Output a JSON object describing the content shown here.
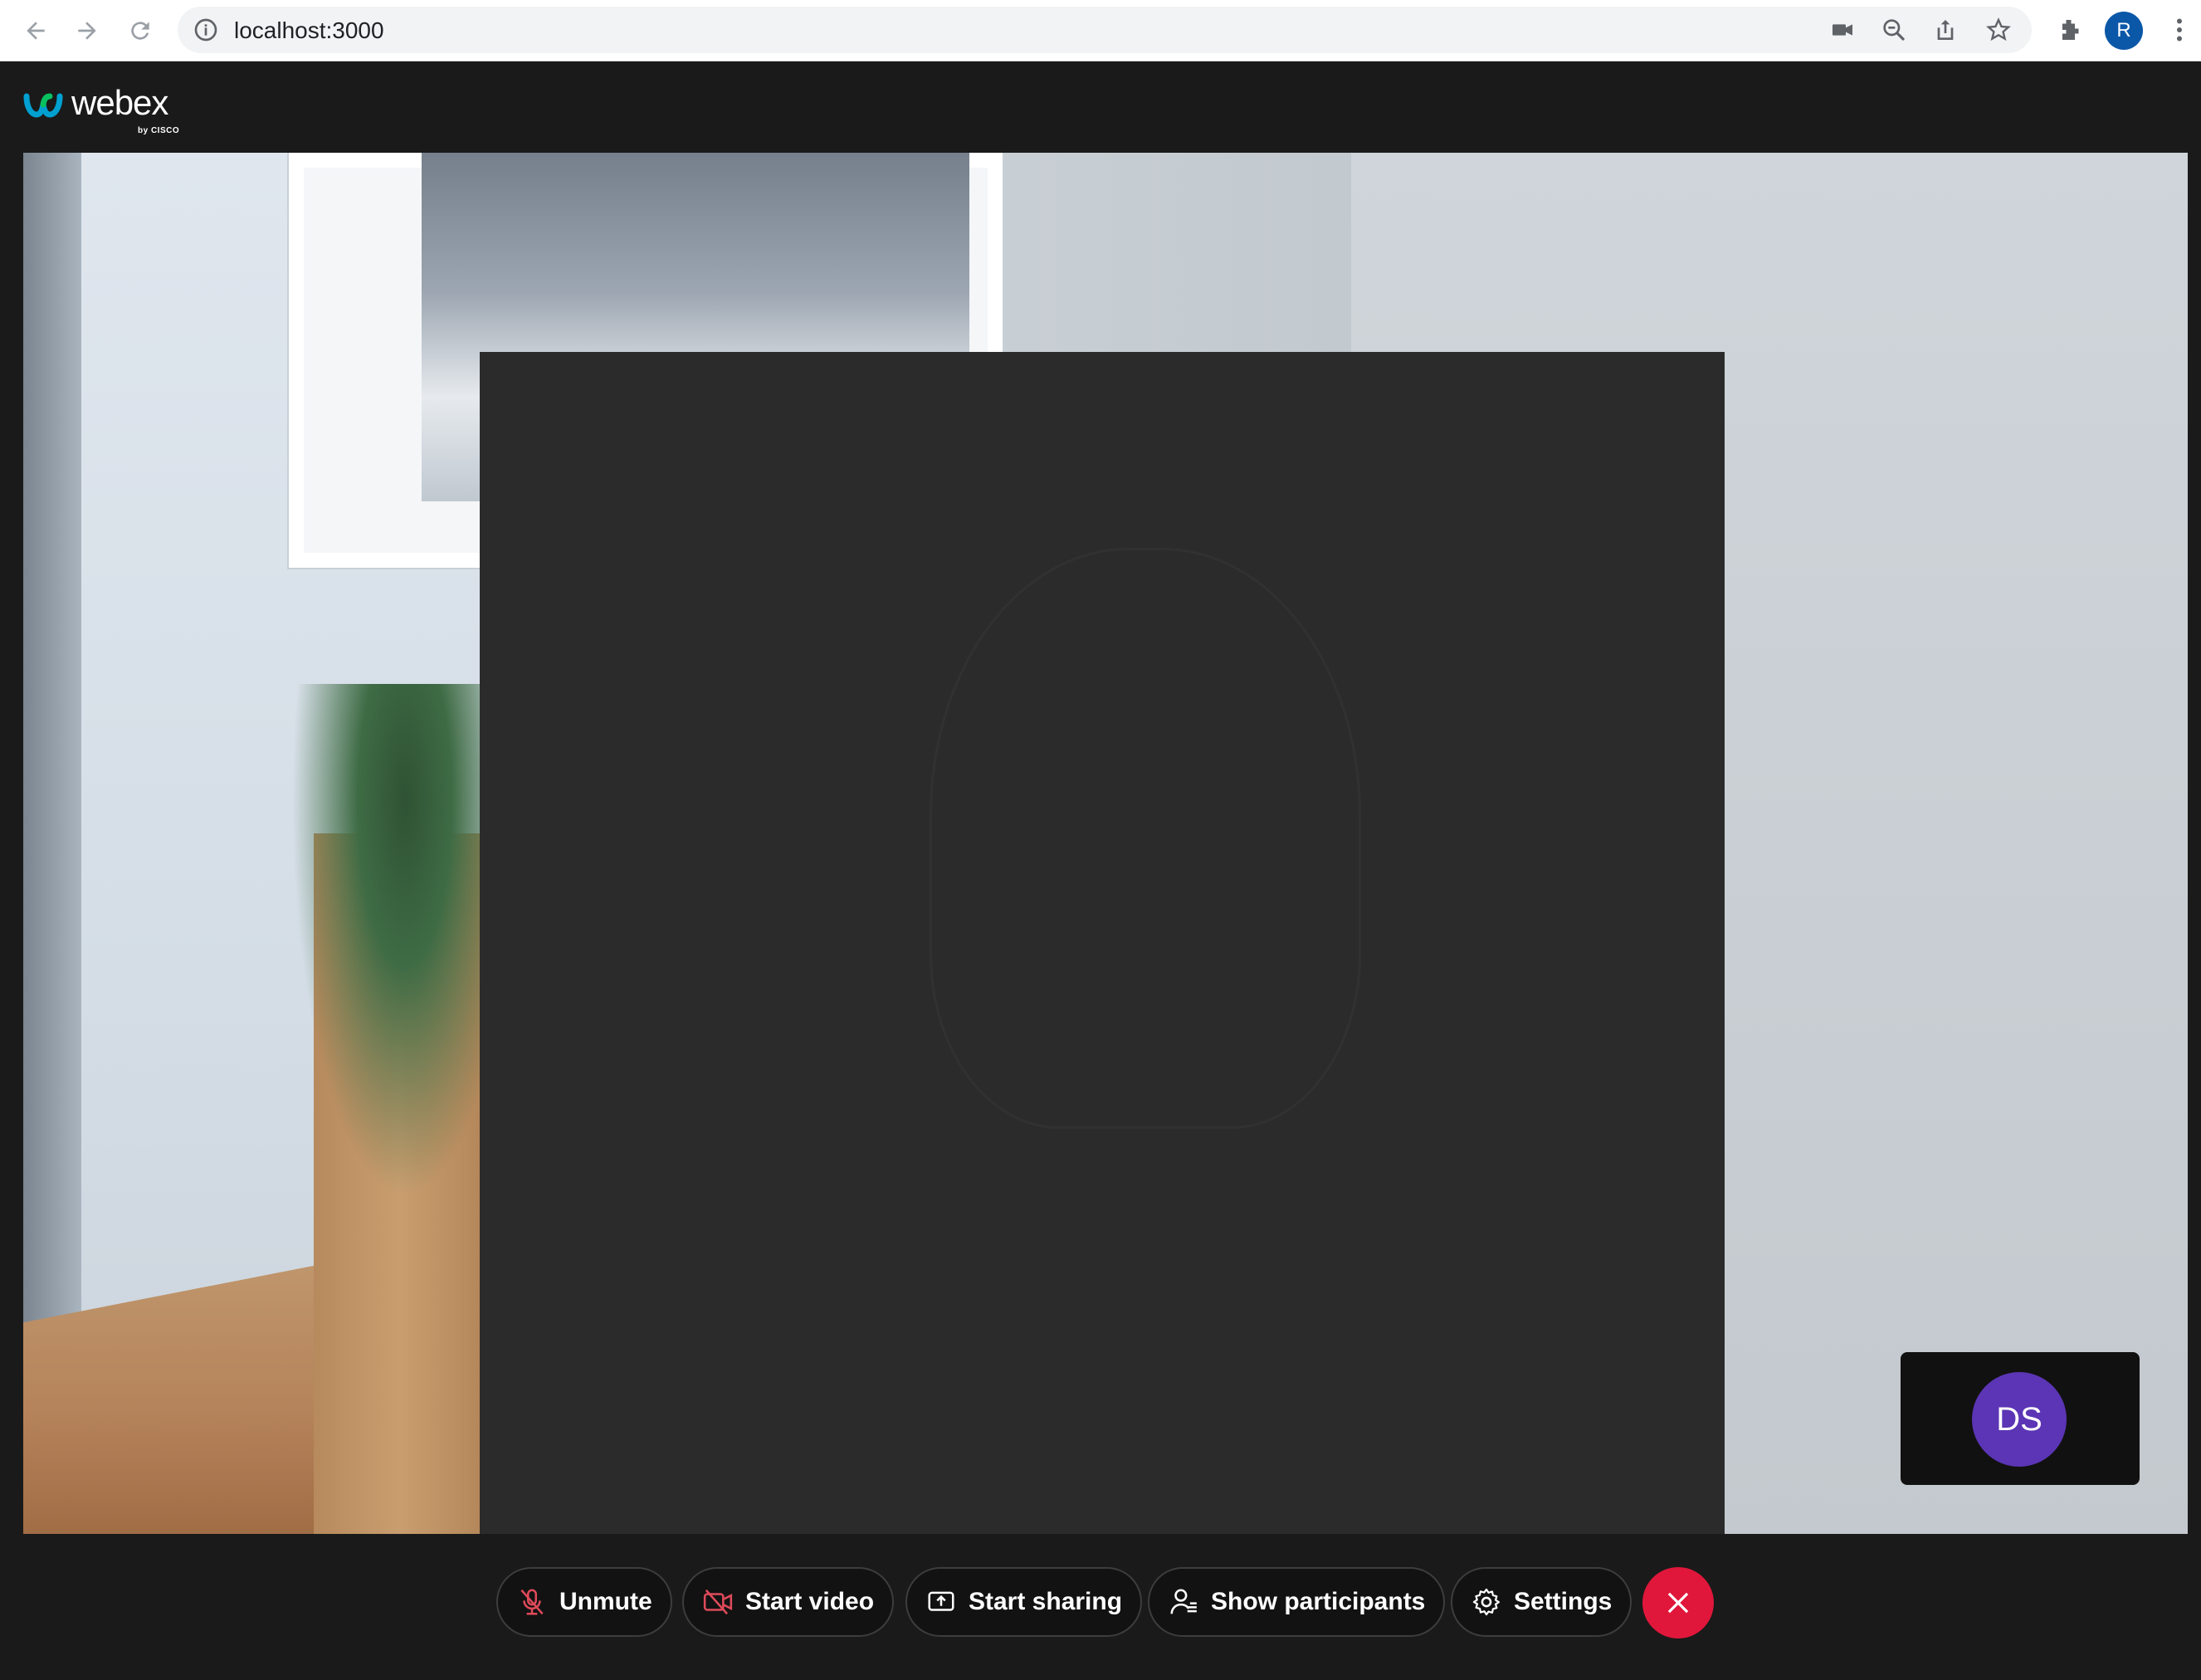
{
  "browser": {
    "url": "localhost:3000",
    "profile_initial": "R",
    "icons": [
      "back-arrow-icon",
      "forward-arrow-icon",
      "reload-icon",
      "info-icon",
      "camera-icon",
      "zoom-out-icon",
      "share-icon",
      "star-icon",
      "extensions-icon",
      "more-vert-icon"
    ]
  },
  "app": {
    "brand": "webex",
    "brand_sub": "by CISCO"
  },
  "stage": {
    "self_initials": "DS"
  },
  "controls": {
    "unmute_label": "Unmute",
    "start_video_label": "Start video",
    "start_sharing_label": "Start sharing",
    "show_participants_label": "Show participants",
    "settings_label": "Settings"
  },
  "colors": {
    "accent_end_call": "#e0173b",
    "avatar": "#5b35b5",
    "muted_icon": "#e04a5a",
    "profile": "#0b57a8"
  }
}
